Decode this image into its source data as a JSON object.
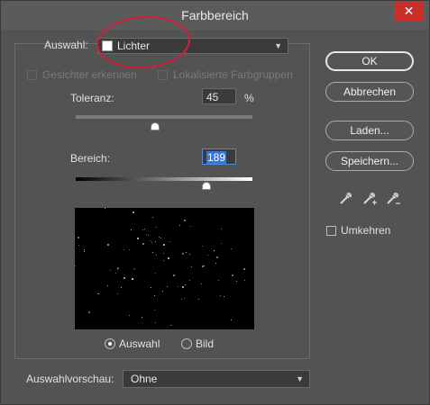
{
  "window": {
    "title": "Farbbereich",
    "close_glyph": "✕"
  },
  "selection": {
    "label": "Auswahl:",
    "value": "Lichter",
    "swatch_color": "#ffffff"
  },
  "options": {
    "faces_label": "Gesichter erkennen",
    "localized_label": "Lokalisierte Farbgruppen"
  },
  "tolerance": {
    "label": "Toleranz:",
    "value": "45",
    "unit": "%",
    "slider_fraction": 0.45
  },
  "range": {
    "label": "Bereich:",
    "value": "189",
    "slider_fraction": 0.74
  },
  "preview_mode": {
    "selection_label": "Auswahl",
    "image_label": "Bild",
    "selected": "Auswahl"
  },
  "selection_preview": {
    "label": "Auswahlvorschau:",
    "value": "Ohne"
  },
  "buttons": {
    "ok": "OK",
    "cancel": "Abbrechen",
    "load": "Laden...",
    "save": "Speichern..."
  },
  "invert": {
    "label": "Umkehren",
    "checked": false
  },
  "icons": [
    "eyedropper-icon",
    "eyedropper-plus-icon",
    "eyedropper-minus-icon"
  ],
  "colors": {
    "annotation_circle": "#d21e3a",
    "close_button": "#c9302c",
    "focus": "#4a8fe0"
  }
}
